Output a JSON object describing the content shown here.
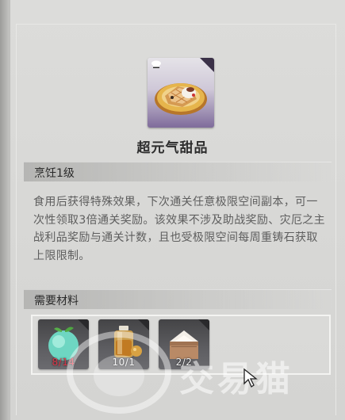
{
  "item": {
    "name": "超元气甜品",
    "icon": "cake-plate-icon"
  },
  "sections": {
    "cooking": {
      "title": "烹饪1级"
    },
    "description": "食用后获得特殊效果，下次通关任意极限空间副本，可一次性领取3倍通关奖励。该效果不涉及助战奖励、灾厄之主战利品奖励与通关计数，且也受极限空间每周重铸石获取上限限制。",
    "materials": {
      "title": "需要材料",
      "items": [
        {
          "name": "green-fruit-icon",
          "count": "8/14",
          "count_color": "#e0384a"
        },
        {
          "name": "honey-jar-icon",
          "count": "10/1"
        },
        {
          "name": "flour-sack-icon",
          "count": "2/2"
        }
      ]
    }
  },
  "watermark": {
    "text": "交易猫"
  },
  "colors": {
    "icon_bg_purple": "#7f6c9b",
    "text_main": "#2d2d2d",
    "text_desc": "#5e5e5e",
    "insufficient": "#e0384a"
  }
}
